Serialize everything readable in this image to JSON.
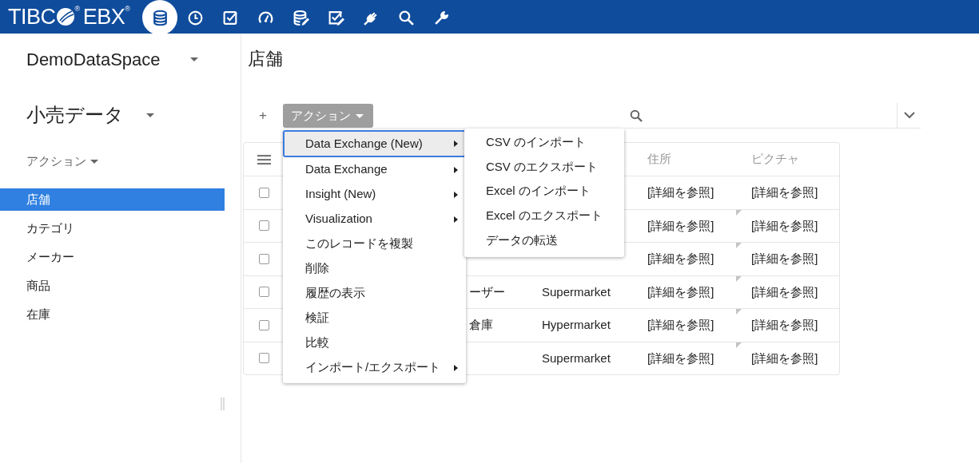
{
  "header": {
    "logo": {
      "text_1": "TIBC",
      "reg_1": "®",
      "text_2": "EBX",
      "reg_2": "®"
    },
    "icons": [
      {
        "kind": "database",
        "selected": true
      },
      {
        "kind": "clock",
        "selected": false
      },
      {
        "kind": "task",
        "selected": false
      },
      {
        "kind": "gauge",
        "selected": false
      },
      {
        "kind": "database-edit",
        "selected": false
      },
      {
        "kind": "task-edit",
        "selected": false
      },
      {
        "kind": "plug",
        "selected": false
      },
      {
        "kind": "search",
        "selected": false
      },
      {
        "kind": "wrench",
        "selected": false
      }
    ]
  },
  "sidebar": {
    "dataspace": "DemoDataSpace",
    "dataset": "小売データ",
    "actions": "アクション",
    "items": [
      {
        "label": "店舗",
        "selected": true
      },
      {
        "label": "カテゴリ",
        "selected": false
      },
      {
        "label": "メーカー",
        "selected": false
      },
      {
        "label": "商品",
        "selected": false
      },
      {
        "label": "在庫",
        "selected": false
      }
    ]
  },
  "main": {
    "title": "店舗",
    "add": "+",
    "action_button": "アクション",
    "table": {
      "columns": [
        "住所",
        "ピクチャ"
      ],
      "rows": [
        {
          "checked": false,
          "address": "[詳細を参照]",
          "picture": "[詳細を参照]",
          "marked": false
        },
        {
          "checked": false,
          "address": "[詳細を参照]",
          "picture": "[詳細を参照]",
          "marked": true
        },
        {
          "checked": false,
          "address": "[詳細を参照]",
          "picture": "[詳細を参照]",
          "marked": true
        },
        {
          "checked": false,
          "name": "ーザー",
          "type": "Supermarket",
          "address": "[詳細を参照]",
          "picture": "[詳細を参照]",
          "marked": true
        },
        {
          "checked": false,
          "name": "倉庫",
          "type": "Hypermarket",
          "address": "[詳細を参照]",
          "picture": "[詳細を参照]",
          "marked": true
        },
        {
          "checked": false,
          "type": "Supermarket",
          "address": "[詳細を参照]",
          "picture": "[詳細を参照]",
          "marked": true
        }
      ]
    },
    "menu": [
      {
        "label": "Data Exchange (New)",
        "kind": "submenu",
        "selected": true
      },
      {
        "label": "Data Exchange",
        "kind": "submenu",
        "selected": false
      },
      {
        "label": "Insight (New)",
        "kind": "submenu",
        "selected": false
      },
      {
        "label": "Visualization",
        "kind": "submenu",
        "selected": false
      },
      {
        "label": "このレコードを複製",
        "kind": "item",
        "selected": false
      },
      {
        "label": "削除",
        "kind": "item",
        "selected": false
      },
      {
        "label": "履歴の表示",
        "kind": "item",
        "selected": false
      },
      {
        "label": "検証",
        "kind": "item",
        "selected": false
      },
      {
        "label": "比較",
        "kind": "item",
        "selected": false
      },
      {
        "label": "インポート/エクスポート",
        "kind": "submenu",
        "selected": false
      }
    ],
    "submenu": [
      "CSV のインポート",
      "CSV のエクスポート",
      "Excel のインポート",
      "Excel のエクスポート",
      "データの転送"
    ]
  }
}
